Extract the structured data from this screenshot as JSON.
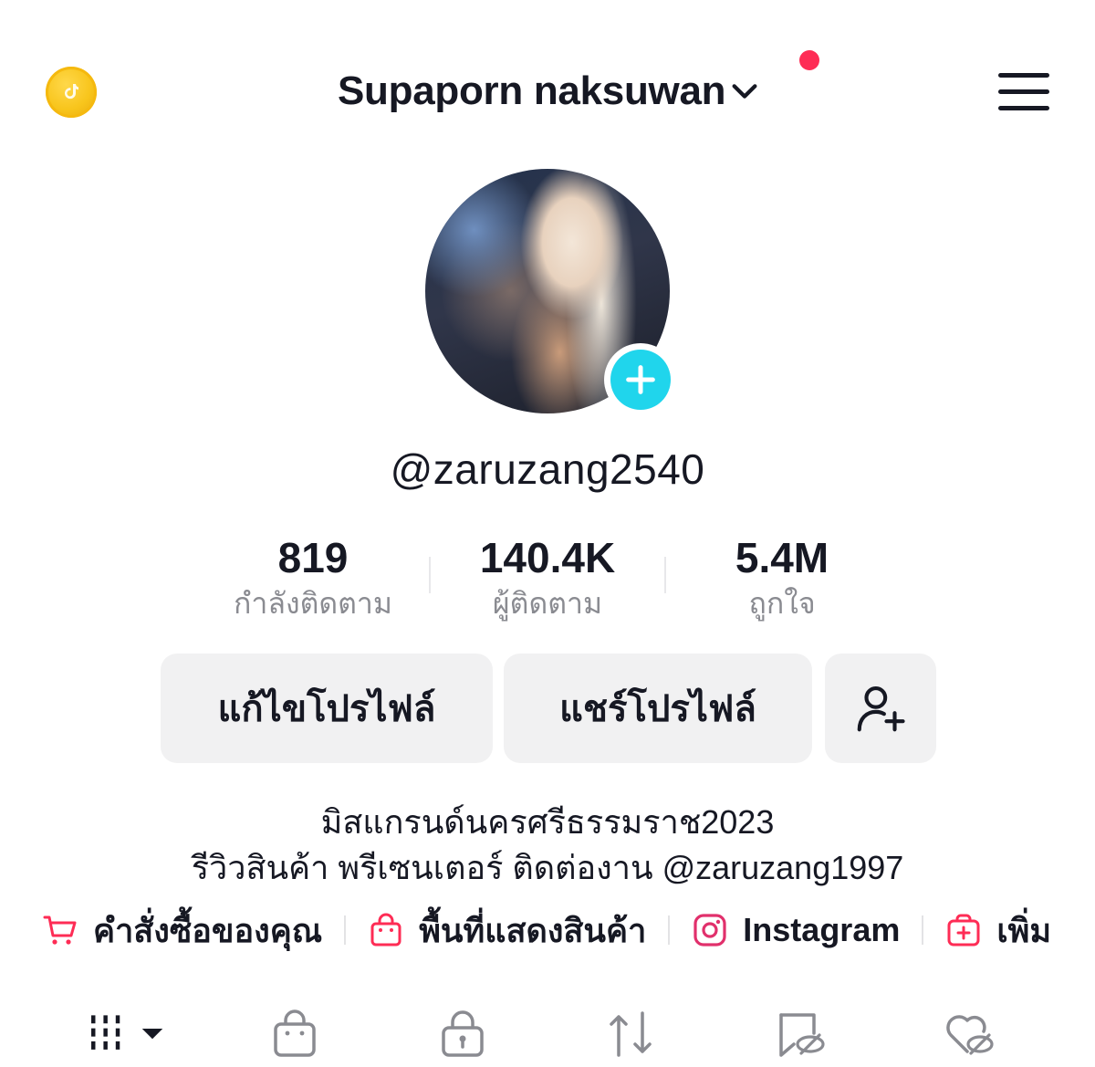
{
  "header": {
    "title": "Supaporn naksuwan",
    "coin_icon": "tiktok-coin-icon",
    "menu_icon": "hamburger-menu-icon",
    "notification_dot_color": "#fe2c55"
  },
  "profile": {
    "username": "@zaruzang2540",
    "add_badge_color": "#20d5ec"
  },
  "stats": [
    {
      "value": "819",
      "label": "กำลังติดตาม"
    },
    {
      "value": "140.4K",
      "label": "ผู้ติดตาม"
    },
    {
      "value": "5.4M",
      "label": "ถูกใจ"
    }
  ],
  "buttons": {
    "edit_profile": "แก้ไขโปรไฟล์",
    "share_profile": "แชร์โปรไฟล์",
    "add_friend_icon": "add-friend-icon"
  },
  "bio": {
    "line1": "มิสแกรนด์นครศรีธรรมราช2023",
    "line2": "รีวิวสินค้า พรีเซนเตอร์ ติดต่องาน @zaruzang1997"
  },
  "links": [
    {
      "label": "คำสั่งซื้อของคุณ",
      "icon": "cart-icon"
    },
    {
      "label": "พื้นที่แสดงสินค้า",
      "icon": "shopping-bag-icon"
    },
    {
      "label": "Instagram",
      "icon": "instagram-icon"
    },
    {
      "label": "เพิ่ม",
      "icon": "add-icon"
    }
  ],
  "tabs": [
    {
      "name": "videos",
      "icon": "grid-icon"
    },
    {
      "name": "shop",
      "icon": "bag-icon"
    },
    {
      "name": "private",
      "icon": "lock-icon"
    },
    {
      "name": "reposts",
      "icon": "repost-icon"
    },
    {
      "name": "favorites",
      "icon": "bookmark-hidden-icon"
    },
    {
      "name": "liked",
      "icon": "heart-hidden-icon"
    }
  ],
  "colors": {
    "accent": "#fe2c55",
    "text": "#161823",
    "muted": "#8a8b91",
    "button_bg": "#f1f1f2"
  }
}
